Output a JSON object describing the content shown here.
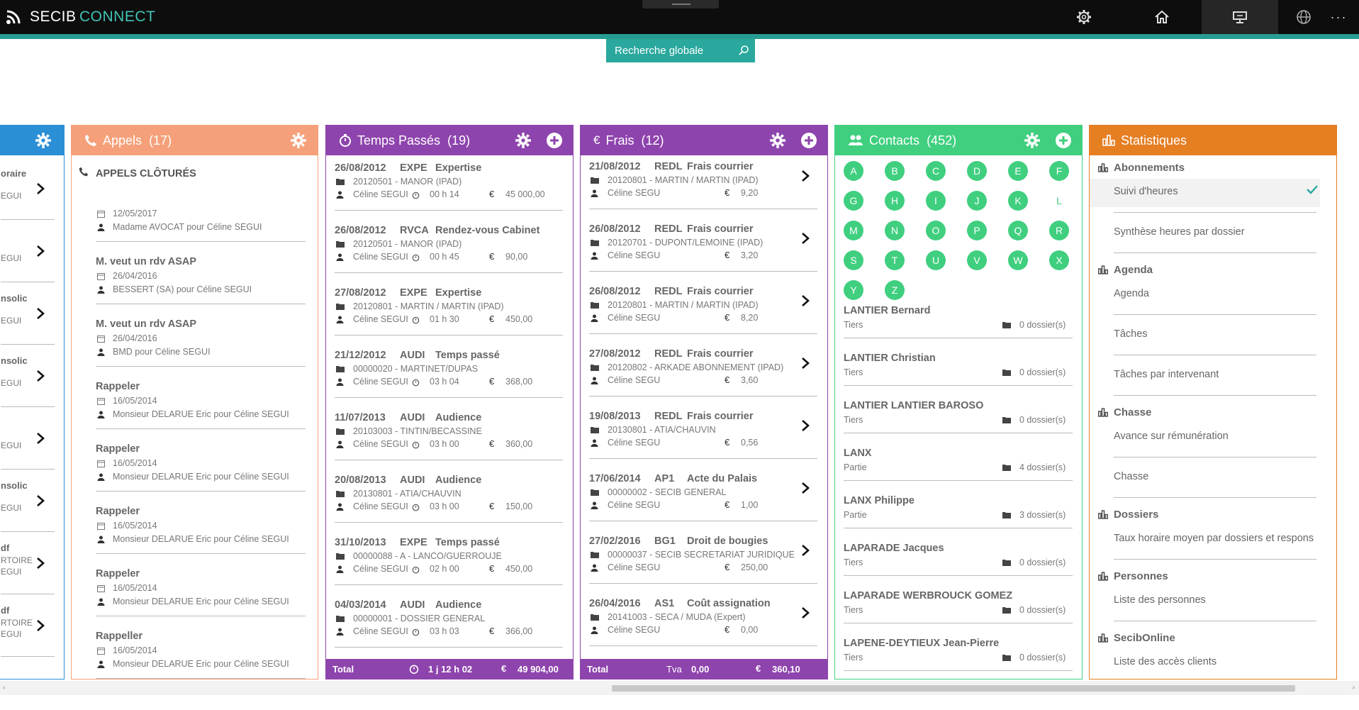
{
  "app": {
    "title_part1": "SECIB",
    "title_part2": "CONNECT",
    "accent": "#279c93"
  },
  "search": {
    "placeholder": "Recherche globale"
  },
  "topnav": {
    "icons": [
      "gear-icon",
      "home-icon",
      "desktop-icon",
      "globe-icon",
      "more-icon"
    ]
  },
  "partial_panel": {
    "rows": [
      {
        "l1": "oraire",
        "l2": "EGUI"
      },
      {
        "l1": "",
        "l2": "EGUI"
      },
      {
        "l1": "nsolic",
        "l2": "EGUI"
      },
      {
        "l1": "nsolic",
        "l2": "EGUI"
      },
      {
        "l1": "",
        "l2": "EGUI"
      },
      {
        "l1": "nsolic",
        "l2": "EGUI"
      },
      {
        "l1": "df",
        "l2": "RTOIRE",
        "l3": "EGUI"
      },
      {
        "l1": "df",
        "l2": "RTOIRE",
        "l3": "EGUI"
      }
    ]
  },
  "appels": {
    "title": "Appels",
    "count": "(17)",
    "color": "#f5a07a",
    "section": "APPELS CLÔTURÉS",
    "items": [
      {
        "title": "",
        "date": "12/05/2017",
        "who": "Madame AVOCAT  pour Céline SEGUI"
      },
      {
        "title": "M. veut un rdv ASAP",
        "date": "26/04/2016",
        "who": "BESSERT (SA) pour Céline SEGUI"
      },
      {
        "title": "M. veut un rdv ASAP",
        "date": "26/04/2016",
        "who": "BMD pour Céline SEGUI"
      },
      {
        "title": "Rappeler",
        "date": "16/05/2014",
        "who": "Monsieur DELARUE Eric pour Céline SEGUI"
      },
      {
        "title": "Rappeler",
        "date": "16/05/2014",
        "who": "Monsieur DELARUE Eric pour Céline SEGUI"
      },
      {
        "title": "Rappeler",
        "date": "16/05/2014",
        "who": "Monsieur DELARUE Eric pour Céline SEGUI"
      },
      {
        "title": "Rappeler",
        "date": "16/05/2014",
        "who": "Monsieur DELARUE Eric pour Céline SEGUI"
      },
      {
        "title": "Rappeller",
        "date": "16/05/2014",
        "who": "Monsieur DELARUE Eric pour Céline SEGUI"
      }
    ]
  },
  "temps": {
    "title": "Temps Passés",
    "count": "(19)",
    "color": "#8e44ad",
    "items": [
      {
        "date": "26/08/2012",
        "code": "EXPE",
        "label": "Expertise",
        "dossier": "20120501 - MANOR (IPAD)",
        "user": "Céline SEGUI",
        "time": "00 h 14",
        "amount": "45 000,00"
      },
      {
        "date": "26/08/2012",
        "code": "RVCA",
        "label": "Rendez-vous Cabinet",
        "dossier": "20120501 - MANOR (IPAD)",
        "user": "Céline SEGUI",
        "time": "00 h 45",
        "amount": "90,00"
      },
      {
        "date": "27/08/2012",
        "code": "EXPE",
        "label": "Expertise",
        "dossier": "20120801 - MARTIN / MARTIN (IPAD)",
        "user": "Céline SEGUI",
        "time": "01 h 30",
        "amount": "450,00"
      },
      {
        "date": "21/12/2012",
        "code": "AUDI",
        "label": "Temps passé",
        "dossier": "00000020 - MARTINET/DUPAS",
        "user": "Céline SEGUI",
        "time": "03 h 04",
        "amount": "368,00"
      },
      {
        "date": "11/07/2013",
        "code": "AUDI",
        "label": "Audience",
        "dossier": "20103003 - TINTIN/BECASSINE",
        "user": "Céline SEGUI",
        "time": "03 h 00",
        "amount": "360,00"
      },
      {
        "date": "20/08/2013",
        "code": "AUDI",
        "label": "Audience",
        "dossier": "20130801 - ATIA/CHAUVIN",
        "user": "Céline SEGUI",
        "time": "03 h 00",
        "amount": "150,00"
      },
      {
        "date": "31/10/2013",
        "code": "EXPE",
        "label": "Temps passé",
        "dossier": "00000088 - A - LANCO/GUERROUJE",
        "user": "Céline SEGUI",
        "time": "02 h 00",
        "amount": "450,00"
      },
      {
        "date": "04/03/2014",
        "code": "AUDI",
        "label": "Audience",
        "dossier": "00000001 -  DOSSIER GENERAL",
        "user": "Céline SEGUI",
        "time": "03 h 03",
        "amount": "366,00"
      }
    ],
    "footer": {
      "label": "Total",
      "time": "1 j 12 h 02",
      "amount": "49 904,00"
    }
  },
  "frais": {
    "title": "Frais",
    "count": "(12)",
    "color": "#8e44ad",
    "items": [
      {
        "date": "21/08/2012",
        "code": "REDL",
        "label": "Frais courrier",
        "dossier": "20120801 - MARTIN / MARTIN (IPAD)",
        "user": "Céline SEGU",
        "amount": "9,20"
      },
      {
        "date": "26/08/2012",
        "code": "REDL",
        "label": "Frais courrier",
        "dossier": "20120701 - DUPONT/LEMOINE (IPAD)",
        "user": "Céline SEGU",
        "amount": "3,20"
      },
      {
        "date": "26/08/2012",
        "code": "REDL",
        "label": "Frais courrier",
        "dossier": "20120801 - MARTIN / MARTIN (IPAD)",
        "user": "Céline SEGU",
        "amount": "8,20"
      },
      {
        "date": "27/08/2012",
        "code": "REDL",
        "label": "Frais courrier",
        "dossier": "20120802 - ARKADE ABONNEMENT (IPAD)",
        "user": "Céline SEGU",
        "amount": "3,60"
      },
      {
        "date": "19/08/2013",
        "code": "REDL",
        "label": "Frais courrier",
        "dossier": "20130801 - ATIA/CHAUVIN",
        "user": "Céline SEGU",
        "amount": "0,56"
      },
      {
        "date": "17/06/2014",
        "code": "AP1",
        "label": "Acte du Palais",
        "dossier": "00000002 - SECIB GENERAL",
        "user": "Céline SEGU",
        "amount": "1,00"
      },
      {
        "date": "27/02/2016",
        "code": "BG1",
        "label": "Droit de bougies",
        "dossier": "00000037 - SECIB SECRETARIAT JURIDIQUE",
        "user": "Céline SEGU",
        "amount": "250,00"
      },
      {
        "date": "26/04/2016",
        "code": "AS1",
        "label": "Coût assignation",
        "dossier": "20141003 - SECA / MUDA (Expert)",
        "user": "Céline SEGU",
        "amount": "0,00"
      }
    ],
    "footer": {
      "label": "Total",
      "tva_label": "Tva",
      "tva": "0,00",
      "amount": "360,10"
    }
  },
  "contacts": {
    "title": "Contacts",
    "count": "(452)",
    "color": "#3fcf7f",
    "letters": [
      "A",
      "B",
      "C",
      "D",
      "E",
      "F",
      "G",
      "H",
      "I",
      "J",
      "K",
      "L",
      "M",
      "N",
      "O",
      "P",
      "Q",
      "R",
      "S",
      "T",
      "U",
      "V",
      "W",
      "X",
      "Y",
      "Z"
    ],
    "items": [
      {
        "name": "LANTIER Bernard",
        "type": "Tiers",
        "dossiers": "0 dossier(s)"
      },
      {
        "name": "LANTIER Christian",
        "type": "Tiers",
        "dossiers": "0 dossier(s)"
      },
      {
        "name": "LANTIER LANTIER BAROSO",
        "type": "Tiers",
        "dossiers": "0 dossier(s)"
      },
      {
        "name": "LANX",
        "type": "Partie",
        "dossiers": "4 dossier(s)"
      },
      {
        "name": "LANX Philippe",
        "type": "Partie",
        "dossiers": "3 dossier(s)"
      },
      {
        "name": "LAPARADE Jacques",
        "type": "Tiers",
        "dossiers": "0 dossier(s)"
      },
      {
        "name": "LAPARADE WERBROUCK GOMEZ",
        "type": "Tiers",
        "dossiers": "0 dossier(s)"
      },
      {
        "name": "LAPENE-DEYTIEUX Jean-Pierre",
        "type": "Tiers",
        "dossiers": "0 dossier(s)"
      }
    ]
  },
  "stats": {
    "title": "Statistiques",
    "color": "#e67e22",
    "groups": [
      {
        "head": "Abonnements",
        "items": [
          "Suivi d'heures",
          "Synthèse heures par dossier"
        ]
      },
      {
        "head": "Agenda",
        "items": [
          "Agenda",
          "Tâches",
          "Tâches par intervenant"
        ]
      },
      {
        "head": "Chasse",
        "items": [
          "Avance sur rémunération",
          "Chasse"
        ]
      },
      {
        "head": "Dossiers",
        "items": [
          "Taux horaire moyen par dossiers et respons"
        ]
      },
      {
        "head": "Personnes",
        "items": [
          "Liste des personnes"
        ]
      },
      {
        "head": "SecibOnline",
        "items": [
          "Liste des accès clients"
        ]
      }
    ]
  }
}
